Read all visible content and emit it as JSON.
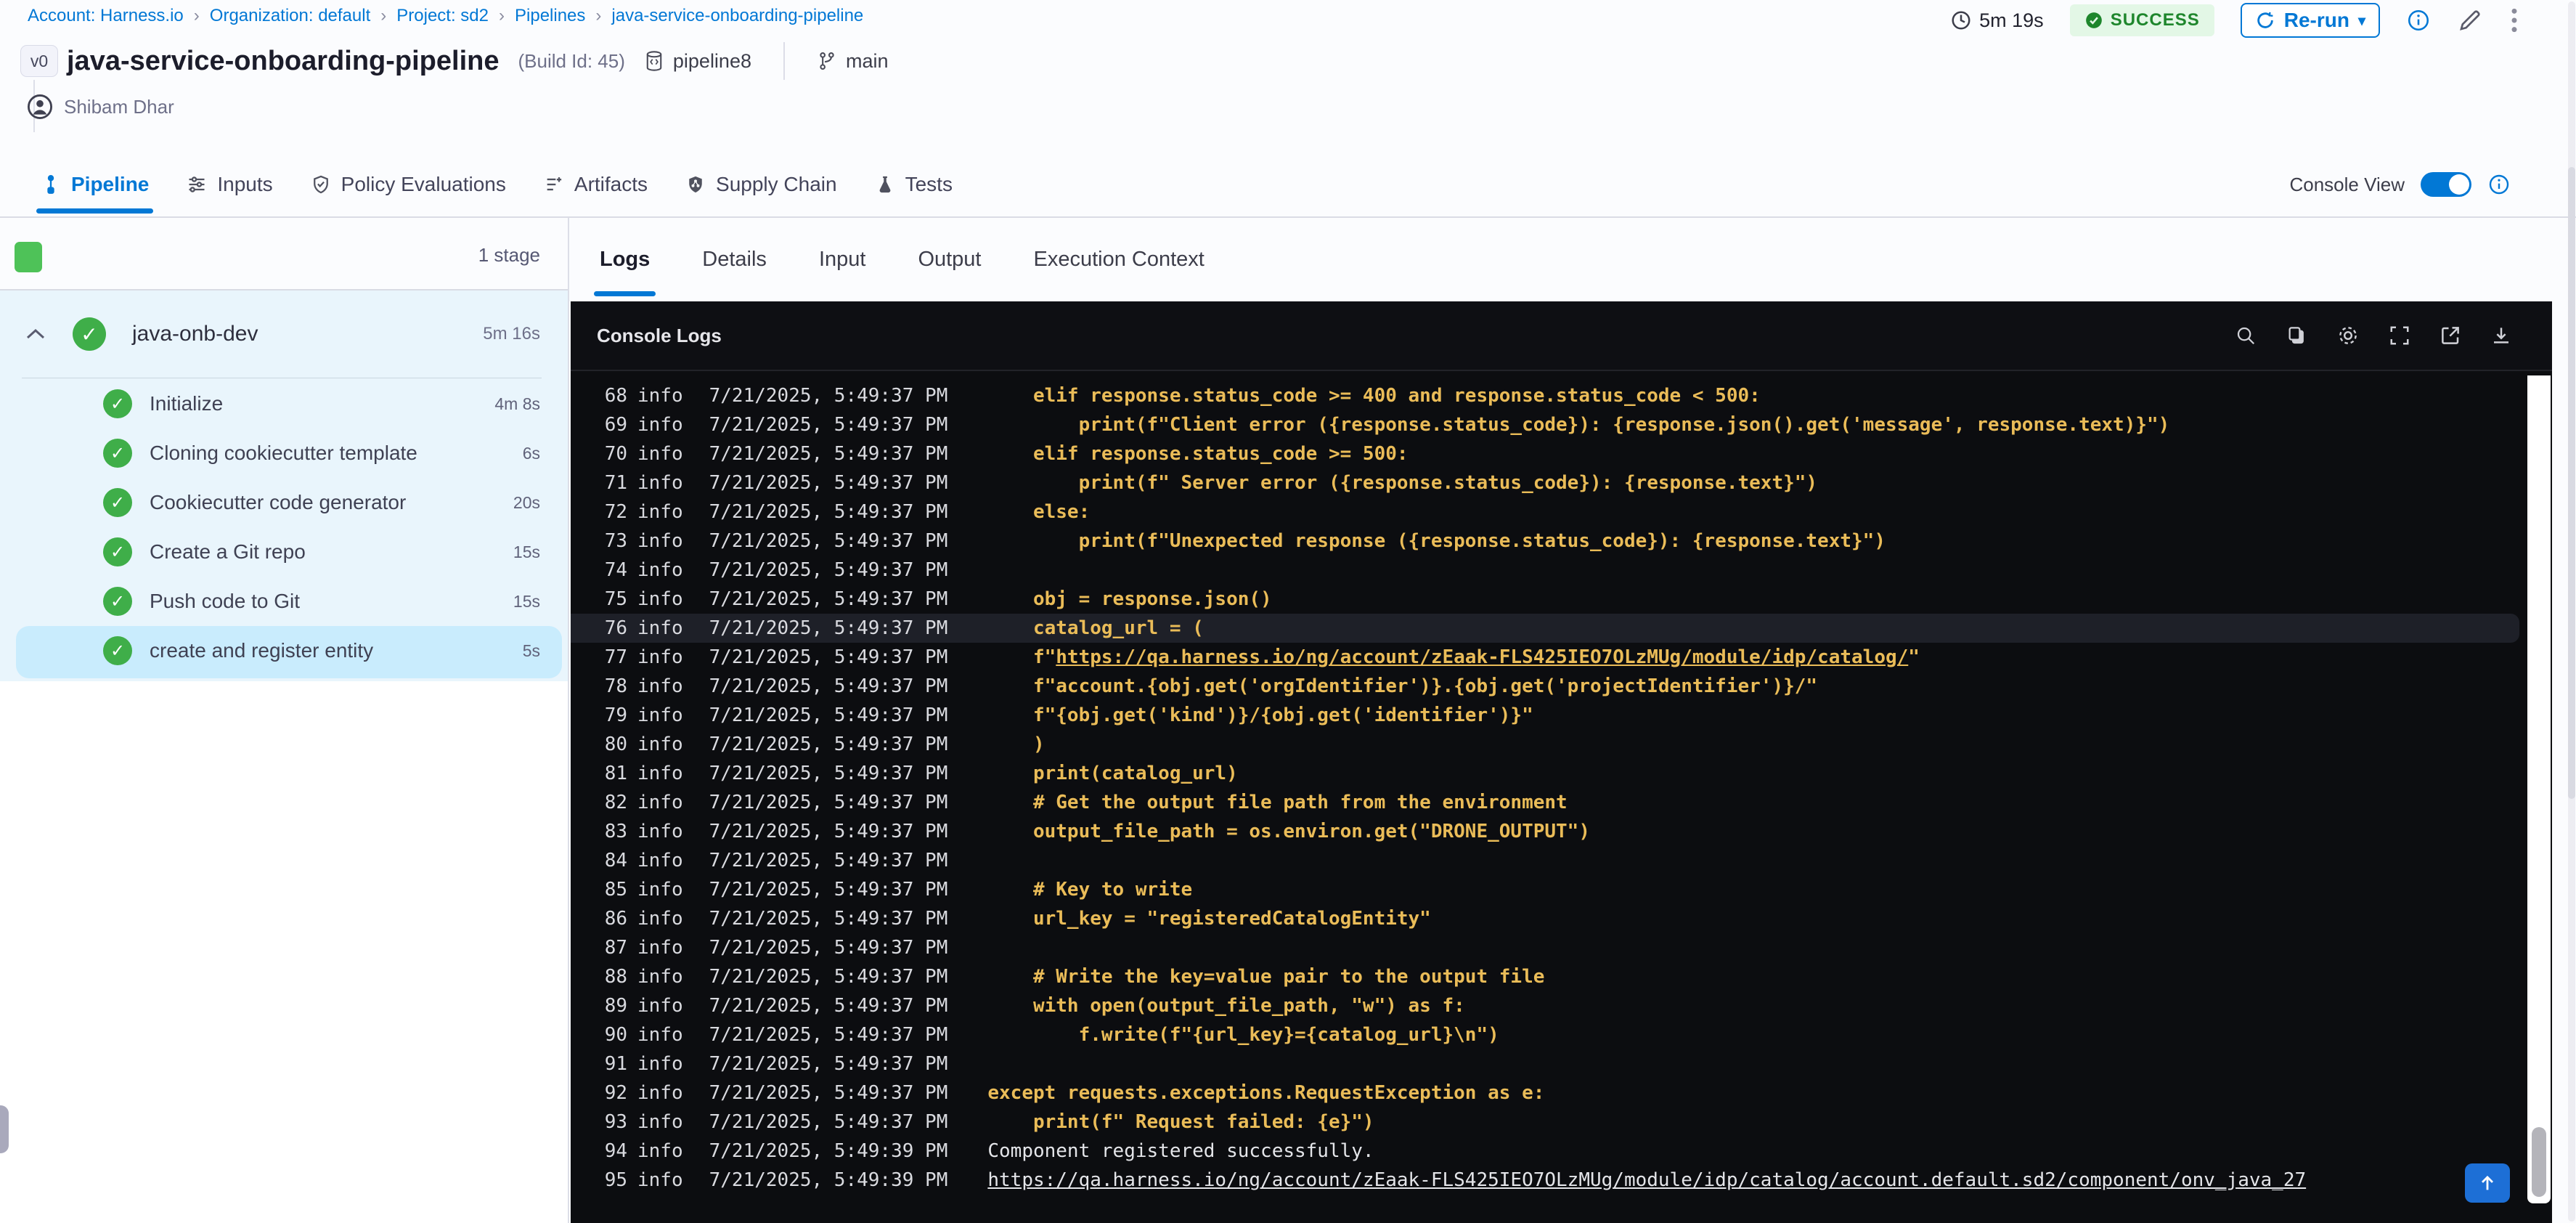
{
  "breadcrumb": {
    "separator": "›",
    "items": [
      {
        "label": "Account: Harness.io"
      },
      {
        "label": "Organization: default"
      },
      {
        "label": "Project: sd2"
      },
      {
        "label": "Pipelines"
      },
      {
        "label": "java-service-onboarding-pipeline"
      }
    ]
  },
  "header": {
    "duration": "5m 19s",
    "status": "SUCCESS",
    "rerun_label": "Re-run",
    "version_badge": "v0",
    "title": "java-service-onboarding-pipeline",
    "build_id": "(Build Id: 45)",
    "pipeline_tag": "pipeline8",
    "branch": "main",
    "user": "Shibam Dhar"
  },
  "tabs": {
    "console_view_label": "Console View",
    "items": [
      {
        "label": "Pipeline",
        "icon": "pipeline-icon",
        "active": true
      },
      {
        "label": "Inputs",
        "icon": "inputs-icon",
        "active": false
      },
      {
        "label": "Policy Evaluations",
        "icon": "policy-evaluations-icon",
        "active": false
      },
      {
        "label": "Artifacts",
        "icon": "artifacts-icon",
        "active": false
      },
      {
        "label": "Supply Chain",
        "icon": "supply-chain-icon",
        "active": false
      },
      {
        "label": "Tests",
        "icon": "tests-icon",
        "active": false
      }
    ]
  },
  "sidebar": {
    "stage_count_label": "1 stage",
    "stage": {
      "name": "java-onb-dev",
      "duration": "5m 16s"
    },
    "steps": [
      {
        "name": "Initialize",
        "duration": "4m 8s",
        "selected": false
      },
      {
        "name": "Cloning cookiecutter template",
        "duration": "6s",
        "selected": false
      },
      {
        "name": "Cookiecutter code generator",
        "duration": "20s",
        "selected": false
      },
      {
        "name": "Create a Git repo",
        "duration": "15s",
        "selected": false
      },
      {
        "name": "Push code to Git",
        "duration": "15s",
        "selected": false
      },
      {
        "name": "create and register entity",
        "duration": "5s",
        "selected": true
      }
    ]
  },
  "panel": {
    "tabs": [
      {
        "label": "Logs",
        "active": true
      },
      {
        "label": "Details",
        "active": false
      },
      {
        "label": "Input",
        "active": false
      },
      {
        "label": "Output",
        "active": false
      },
      {
        "label": "Execution Context",
        "active": false
      }
    ]
  },
  "console": {
    "title": "Console Logs",
    "icons": [
      "search-icon",
      "copy-icon",
      "settings-icon",
      "fullscreen-icon",
      "open-in-new-icon",
      "download-icon"
    ],
    "colors": {
      "code": "#eabc58",
      "plain": "#e4e5e9",
      "background": "#0c0d10",
      "highlight_row": "#1e2028"
    },
    "logs": [
      {
        "n": "68",
        "level": "info",
        "time": "7/21/2025, 5:49:37 PM",
        "segs": [
          {
            "t": "    elif response.status_code >= 400 and response.status_code < 500:"
          }
        ]
      },
      {
        "n": "69",
        "level": "info",
        "time": "7/21/2025, 5:49:37 PM",
        "segs": [
          {
            "t": "        print(f\"Client error ({response.status_code}): {response.json().get('message', response.text)}\")"
          }
        ]
      },
      {
        "n": "70",
        "level": "info",
        "time": "7/21/2025, 5:49:37 PM",
        "segs": [
          {
            "t": "    elif response.status_code >= 500:"
          }
        ]
      },
      {
        "n": "71",
        "level": "info",
        "time": "7/21/2025, 5:49:37 PM",
        "segs": [
          {
            "t": "        print(f\" Server error ({response.status_code}): {response.text}\")"
          }
        ]
      },
      {
        "n": "72",
        "level": "info",
        "time": "7/21/2025, 5:49:37 PM",
        "segs": [
          {
            "t": "    else:"
          }
        ]
      },
      {
        "n": "73",
        "level": "info",
        "time": "7/21/2025, 5:49:37 PM",
        "segs": [
          {
            "t": "        print(f\"Unexpected response ({response.status_code}): {response.text}\")"
          }
        ]
      },
      {
        "n": "74",
        "level": "info",
        "time": "7/21/2025, 5:49:37 PM",
        "segs": []
      },
      {
        "n": "75",
        "level": "info",
        "time": "7/21/2025, 5:49:37 PM",
        "segs": [
          {
            "t": "    obj = response.json()"
          }
        ]
      },
      {
        "n": "76",
        "level": "info",
        "time": "7/21/2025, 5:49:37 PM",
        "hl": true,
        "segs": [
          {
            "t": "    catalog_url = ("
          }
        ]
      },
      {
        "n": "77",
        "level": "info",
        "time": "7/21/2025, 5:49:37 PM",
        "segs": [
          {
            "t": "    f\""
          },
          {
            "t": "https://qa.harness.io/ng/account/zEaak-FLS425IEO7OLzMUg/module/idp/catalog/",
            "link": true
          },
          {
            "t": "\""
          }
        ]
      },
      {
        "n": "78",
        "level": "info",
        "time": "7/21/2025, 5:49:37 PM",
        "segs": [
          {
            "t": "    f\"account.{obj.get('orgIdentifier')}.{obj.get('projectIdentifier')}/\""
          }
        ]
      },
      {
        "n": "79",
        "level": "info",
        "time": "7/21/2025, 5:49:37 PM",
        "segs": [
          {
            "t": "    f\"{obj.get('kind')}/{obj.get('identifier')}\""
          }
        ]
      },
      {
        "n": "80",
        "level": "info",
        "time": "7/21/2025, 5:49:37 PM",
        "segs": [
          {
            "t": "    )"
          }
        ]
      },
      {
        "n": "81",
        "level": "info",
        "time": "7/21/2025, 5:49:37 PM",
        "segs": [
          {
            "t": "    print(catalog_url)"
          }
        ]
      },
      {
        "n": "82",
        "level": "info",
        "time": "7/21/2025, 5:49:37 PM",
        "segs": [
          {
            "t": "    # Get the output file path from the environment"
          }
        ]
      },
      {
        "n": "83",
        "level": "info",
        "time": "7/21/2025, 5:49:37 PM",
        "segs": [
          {
            "t": "    output_file_path = os.environ.get(\"DRONE_OUTPUT\")"
          }
        ]
      },
      {
        "n": "84",
        "level": "info",
        "time": "7/21/2025, 5:49:37 PM",
        "segs": []
      },
      {
        "n": "85",
        "level": "info",
        "time": "7/21/2025, 5:49:37 PM",
        "segs": [
          {
            "t": "    # Key to write"
          }
        ]
      },
      {
        "n": "86",
        "level": "info",
        "time": "7/21/2025, 5:49:37 PM",
        "segs": [
          {
            "t": "    url_key = \"registeredCatalogEntity\""
          }
        ]
      },
      {
        "n": "87",
        "level": "info",
        "time": "7/21/2025, 5:49:37 PM",
        "segs": []
      },
      {
        "n": "88",
        "level": "info",
        "time": "7/21/2025, 5:49:37 PM",
        "segs": [
          {
            "t": "    # Write the key=value pair to the output file"
          }
        ]
      },
      {
        "n": "89",
        "level": "info",
        "time": "7/21/2025, 5:49:37 PM",
        "segs": [
          {
            "t": "    with open(output_file_path, \"w\") as f:"
          }
        ]
      },
      {
        "n": "90",
        "level": "info",
        "time": "7/21/2025, 5:49:37 PM",
        "segs": [
          {
            "t": "        f.write(f\"{url_key}={catalog_url}\\n\")"
          }
        ]
      },
      {
        "n": "91",
        "level": "info",
        "time": "7/21/2025, 5:49:37 PM",
        "segs": []
      },
      {
        "n": "92",
        "level": "info",
        "time": "7/21/2025, 5:49:37 PM",
        "segs": [
          {
            "t": "except requests.exceptions.RequestException as e:"
          }
        ]
      },
      {
        "n": "93",
        "level": "info",
        "time": "7/21/2025, 5:49:37 PM",
        "segs": [
          {
            "t": "    print(f\" Request failed: {e}\")"
          }
        ]
      },
      {
        "n": "94",
        "level": "info",
        "time": "7/21/2025, 5:49:39 PM",
        "kind": "out",
        "segs": [
          {
            "t": "Component registered successfully."
          }
        ]
      },
      {
        "n": "95",
        "level": "info",
        "time": "7/21/2025, 5:49:39 PM",
        "kind": "out",
        "segs": [
          {
            "t": "https://qa.harness.io/ng/account/zEaak-FLS425IEO7OLzMUg/module/idp/catalog/account.default.sd2/component/onv_java_27",
            "link": true
          }
        ]
      }
    ]
  },
  "colors": {
    "accent_blue": "#0278d5",
    "success_green": "#3fae49",
    "badge_green_bg": "#e3f7e6",
    "badge_green_text": "#1e862c"
  }
}
